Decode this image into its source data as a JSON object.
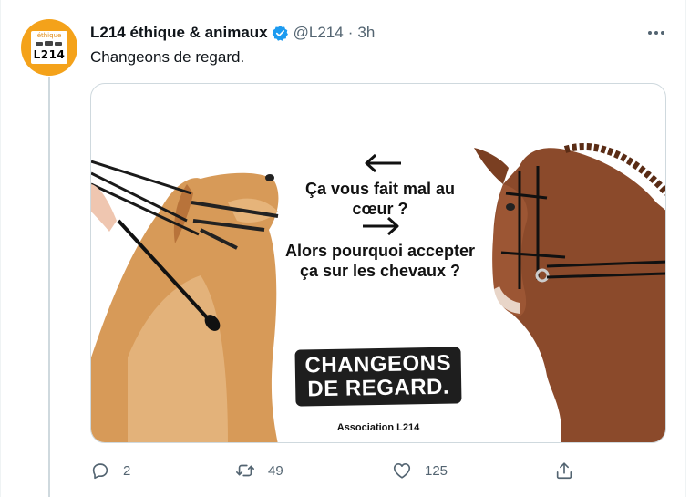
{
  "tweet": {
    "author_name": "L214 éthique & animaux",
    "handle": "@L214",
    "separator": "·",
    "time": "3h",
    "text": "Changeons de regard.",
    "verified_icon": "verified-badge-icon",
    "avatar": {
      "top_text": "éthique",
      "code_text": "L214"
    }
  },
  "media": {
    "question_1": "Ça vous fait mal au cœur ?",
    "question_2": "Alors pourquoi accepter ça sur les chevaux ?",
    "badge_line_1": "CHANGEONS",
    "badge_line_2": "DE REGARD.",
    "association": "Association L214"
  },
  "actions": {
    "reply": {
      "icon": "reply-icon",
      "count": "2"
    },
    "retweet": {
      "icon": "retweet-icon",
      "count": "49"
    },
    "like": {
      "icon": "heart-icon",
      "count": "125"
    },
    "share": {
      "icon": "share-icon"
    }
  },
  "colors": {
    "brand_orange": "#f4a21a",
    "verified_blue": "#1d9bf0",
    "secondary_text": "#536471"
  }
}
